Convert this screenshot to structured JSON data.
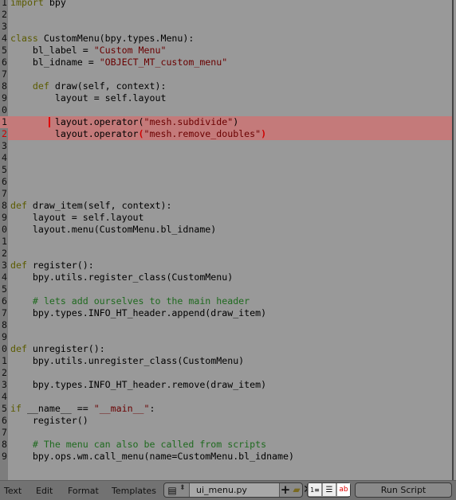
{
  "editor": {
    "current_line": 12,
    "highlight_color": "#c47a7a",
    "lines": [
      {
        "n": "1",
        "seg": [
          [
            "import",
            "kw"
          ],
          [
            " bpy",
            ""
          ]
        ]
      },
      {
        "n": "2",
        "seg": []
      },
      {
        "n": "3",
        "seg": []
      },
      {
        "n": "4",
        "seg": [
          [
            "class",
            "kw"
          ],
          [
            " CustomMenu(bpy.types.Menu):",
            ""
          ]
        ]
      },
      {
        "n": "5",
        "seg": [
          [
            "    bl_label = ",
            ""
          ],
          [
            "\"Custom Menu\"",
            "str"
          ]
        ]
      },
      {
        "n": "6",
        "seg": [
          [
            "    bl_idname = ",
            ""
          ],
          [
            "\"OBJECT_MT_custom_menu\"",
            "str"
          ]
        ]
      },
      {
        "n": "7",
        "seg": []
      },
      {
        "n": "8",
        "seg": [
          [
            "    ",
            ""
          ],
          [
            "def",
            "kw"
          ],
          [
            " draw(self, context):",
            ""
          ]
        ]
      },
      {
        "n": "9",
        "seg": [
          [
            "        layout = self.layout",
            ""
          ]
        ]
      },
      {
        "n": "0",
        "seg": []
      },
      {
        "n": "1",
        "sel": true,
        "cursor": true,
        "seg": [
          [
            "        layout.operator(",
            ""
          ],
          [
            "\"mesh.subdivide\"",
            "str"
          ],
          [
            ")",
            ""
          ]
        ]
      },
      {
        "n": "2",
        "sel": true,
        "red": true,
        "seg": [
          [
            "        layout.operator",
            ""
          ],
          [
            "(",
            "br"
          ],
          [
            "\"mesh.remove_doubles\"",
            "str"
          ],
          [
            ")",
            "br"
          ]
        ]
      },
      {
        "n": "3",
        "seg": []
      },
      {
        "n": "4",
        "seg": []
      },
      {
        "n": "5",
        "seg": []
      },
      {
        "n": "6",
        "seg": []
      },
      {
        "n": "7",
        "seg": []
      },
      {
        "n": "8",
        "seg": [
          [
            "def",
            "kw"
          ],
          [
            " draw_item(self, context):",
            ""
          ]
        ]
      },
      {
        "n": "9",
        "seg": [
          [
            "    layout = self.layout",
            ""
          ]
        ]
      },
      {
        "n": "0",
        "seg": [
          [
            "    layout.menu(CustomMenu.bl_idname)",
            ""
          ]
        ]
      },
      {
        "n": "1",
        "seg": []
      },
      {
        "n": "2",
        "seg": []
      },
      {
        "n": "3",
        "seg": [
          [
            "def",
            "kw"
          ],
          [
            " register():",
            ""
          ]
        ]
      },
      {
        "n": "4",
        "seg": [
          [
            "    bpy.utils.register_class(CustomMenu)",
            ""
          ]
        ]
      },
      {
        "n": "5",
        "seg": []
      },
      {
        "n": "6",
        "seg": [
          [
            "    # lets add ourselves to the main header",
            "cm"
          ]
        ]
      },
      {
        "n": "7",
        "seg": [
          [
            "    bpy.types.INFO_HT_header.append(draw_item)",
            ""
          ]
        ]
      },
      {
        "n": "8",
        "seg": []
      },
      {
        "n": "9",
        "seg": []
      },
      {
        "n": "0",
        "seg": [
          [
            "def",
            "kw"
          ],
          [
            " unregister():",
            ""
          ]
        ]
      },
      {
        "n": "1",
        "seg": [
          [
            "    bpy.utils.unregister_class(CustomMenu)",
            ""
          ]
        ]
      },
      {
        "n": "2",
        "seg": []
      },
      {
        "n": "3",
        "seg": [
          [
            "    bpy.types.INFO_HT_header.remove(draw_item)",
            ""
          ]
        ]
      },
      {
        "n": "4",
        "seg": []
      },
      {
        "n": "5",
        "seg": [
          [
            "if",
            "kw"
          ],
          [
            " __name__ == ",
            ""
          ],
          [
            "\"__main__\"",
            "str"
          ],
          [
            ":",
            ""
          ]
        ]
      },
      {
        "n": "6",
        "seg": [
          [
            "    register()",
            ""
          ]
        ]
      },
      {
        "n": "7",
        "seg": []
      },
      {
        "n": "8",
        "seg": [
          [
            "    # The menu can also be called from scripts",
            "cm"
          ]
        ]
      },
      {
        "n": "9",
        "seg": [
          [
            "    bpy.ops.wm.call_menu(name=CustomMenu.bl_idname)",
            ""
          ]
        ]
      }
    ]
  },
  "footer": {
    "menus": [
      "Text",
      "Edit",
      "Format",
      "Templates"
    ],
    "file_name": "ui_menu.py",
    "run_script": "Run Script",
    "icons": [
      "text-datablock-icon",
      "new-file-icon",
      "open-file-icon",
      "unlink-icon",
      "line-numbers-icon",
      "word-wrap-icon",
      "syntax-highlight-icon"
    ]
  }
}
